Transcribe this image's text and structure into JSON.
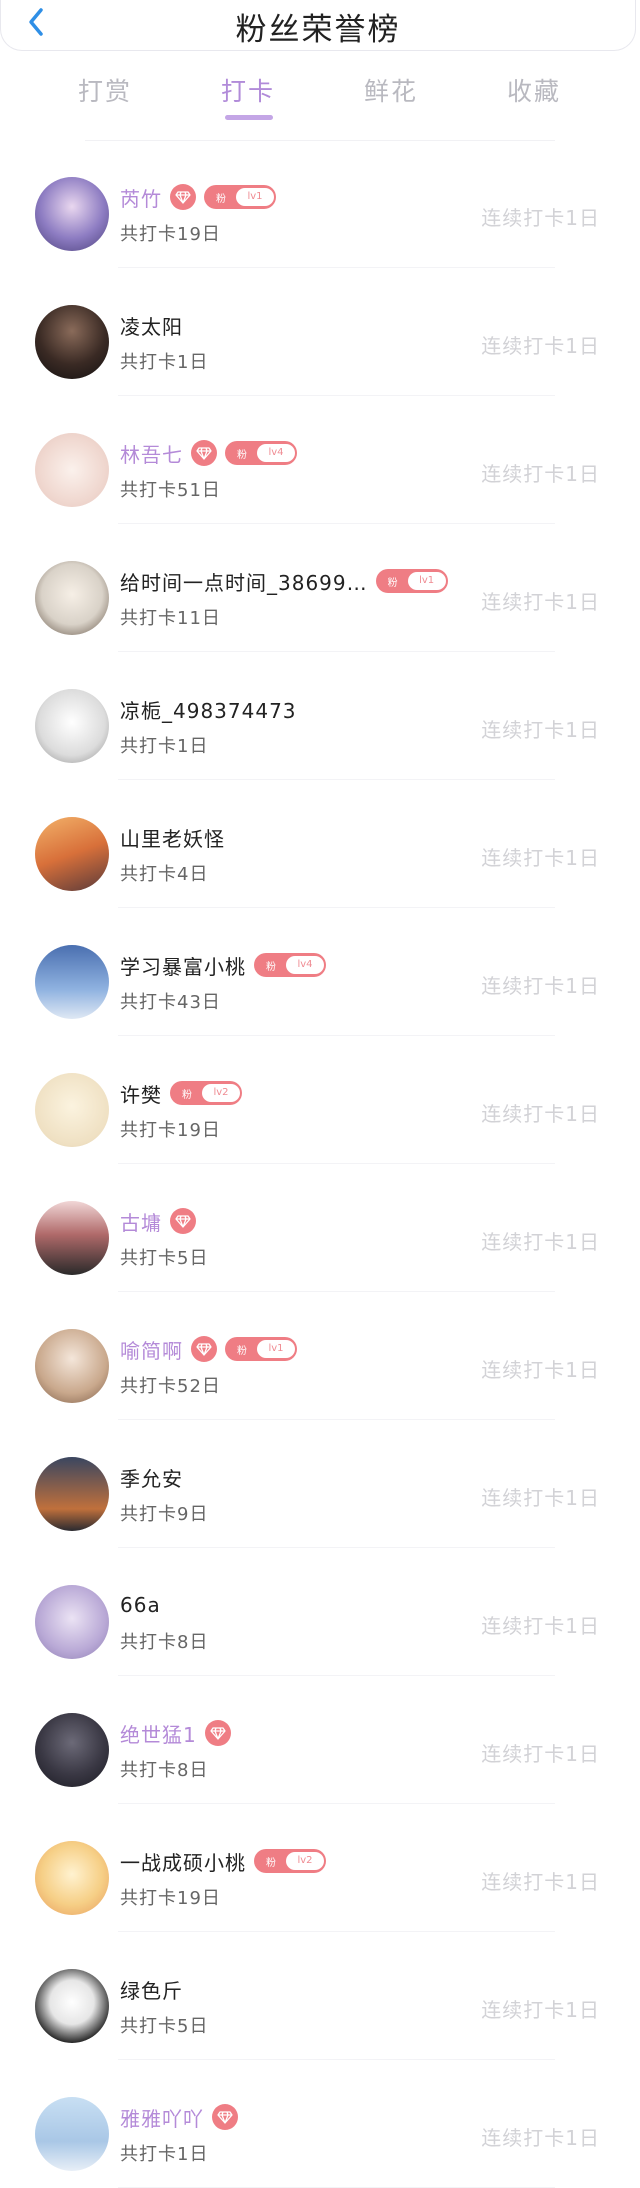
{
  "header": {
    "title": "粉丝荣誉榜"
  },
  "tabs": [
    {
      "label": "打赏",
      "active": false
    },
    {
      "label": "打卡",
      "active": true
    },
    {
      "label": "鲜花",
      "active": false
    },
    {
      "label": "收藏",
      "active": false
    }
  ],
  "colors": {
    "accent": "#b18bd9",
    "badge": "#ef7d84",
    "vip_name": "#b48ad8"
  },
  "fans": [
    {
      "name": "芮竹",
      "vip": true,
      "diamond": true,
      "fan_level": "lv1",
      "total": "共打卡19日",
      "streak": "连续打卡1日"
    },
    {
      "name": "凌太阳",
      "vip": false,
      "diamond": false,
      "fan_level": "",
      "total": "共打卡1日",
      "streak": "连续打卡1日"
    },
    {
      "name": "林吾七",
      "vip": true,
      "diamond": true,
      "fan_level": "lv4",
      "total": "共打卡51日",
      "streak": "连续打卡1日"
    },
    {
      "name": "给时间一点时间_38699…",
      "vip": false,
      "diamond": false,
      "fan_level": "lv1",
      "total": "共打卡11日",
      "streak": "连续打卡1日"
    },
    {
      "name": "凉栀_498374473",
      "vip": false,
      "diamond": false,
      "fan_level": "",
      "total": "共打卡1日",
      "streak": "连续打卡1日"
    },
    {
      "name": "山里老妖怪",
      "vip": false,
      "diamond": false,
      "fan_level": "",
      "total": "共打卡4日",
      "streak": "连续打卡1日"
    },
    {
      "name": "学习暴富小桃",
      "vip": false,
      "diamond": false,
      "fan_level": "lv4",
      "total": "共打卡43日",
      "streak": "连续打卡1日"
    },
    {
      "name": "许樊",
      "vip": false,
      "diamond": false,
      "fan_level": "lv2",
      "total": "共打卡19日",
      "streak": "连续打卡1日"
    },
    {
      "name": "古墉",
      "vip": true,
      "diamond": true,
      "fan_level": "",
      "total": "共打卡5日",
      "streak": "连续打卡1日"
    },
    {
      "name": "喻简啊",
      "vip": true,
      "diamond": true,
      "fan_level": "lv1",
      "total": "共打卡52日",
      "streak": "连续打卡1日"
    },
    {
      "name": "季允安",
      "vip": false,
      "diamond": false,
      "fan_level": "",
      "total": "共打卡9日",
      "streak": "连续打卡1日"
    },
    {
      "name": "66a",
      "vip": false,
      "diamond": false,
      "fan_level": "",
      "total": "共打卡8日",
      "streak": "连续打卡1日"
    },
    {
      "name": "绝世猛1",
      "vip": true,
      "diamond": true,
      "fan_level": "",
      "total": "共打卡8日",
      "streak": "连续打卡1日"
    },
    {
      "name": "一战成硕小桃",
      "vip": false,
      "diamond": false,
      "fan_level": "lv2",
      "total": "共打卡19日",
      "streak": "连续打卡1日"
    },
    {
      "name": "绿色斤",
      "vip": false,
      "diamond": false,
      "fan_level": "",
      "total": "共打卡5日",
      "streak": "连续打卡1日"
    },
    {
      "name": "雅雅吖吖",
      "vip": true,
      "diamond": true,
      "fan_level": "",
      "total": "共打卡1日",
      "streak": "连续打卡1日"
    }
  ],
  "fan_badge_char": "粉"
}
